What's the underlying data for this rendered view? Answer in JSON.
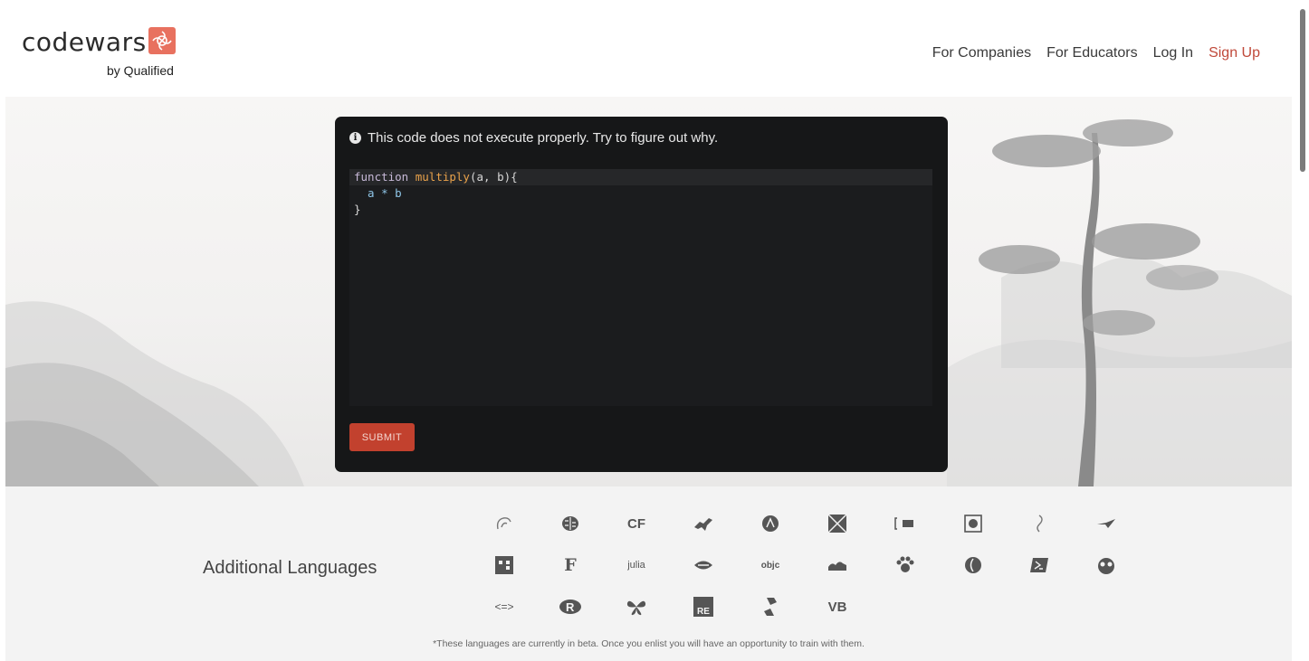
{
  "brand": {
    "name": "codewars",
    "tagline": "by Qualified",
    "accent": "#e8715f"
  },
  "nav": {
    "companies": "For Companies",
    "educators": "For Educators",
    "login": "Log In",
    "signup": "Sign Up"
  },
  "challenge": {
    "message": "This code does not execute properly. Try to figure out why.",
    "code": {
      "l1_kw": "function",
      "l1_fn": "multiply",
      "l1_args": "(a, b){",
      "l2": "  a * b",
      "l3": "}"
    },
    "submit_label": "SUBMIT"
  },
  "languages": {
    "title": "Additional Languages",
    "note": "*These languages are currently in beta. Once you enlist you will have an opportunity to train with them.",
    "icons": [
      "agda-icon",
      "brainfuck-icon",
      "cfml-icon",
      "cobol-icon",
      "coq-icon",
      "elm-icon",
      "erlang-icon",
      "factor-icon",
      "forth-icon",
      "fortran-icon",
      "fsharp-icon",
      "fsharp-f-icon",
      "julia-icon",
      "lambdacalc-icon",
      "objc-icon",
      "ocaml-icon",
      "pascal-icon",
      "perl-icon",
      "powershell-icon",
      "prolog-icon",
      "purescript-icon",
      "r-icon",
      "raku-icon",
      "reason-icon",
      "solidity-icon",
      "vb-icon"
    ],
    "texts": {
      "cf": "CF",
      "f": "F",
      "julia": "julia",
      "objc": "objc",
      "re": "RE",
      "vb": "VB",
      "purs": "<=>"
    }
  },
  "colors": {
    "card_bg": "#161718",
    "submit_bg": "#c2412e",
    "signup": "#c0493a"
  }
}
